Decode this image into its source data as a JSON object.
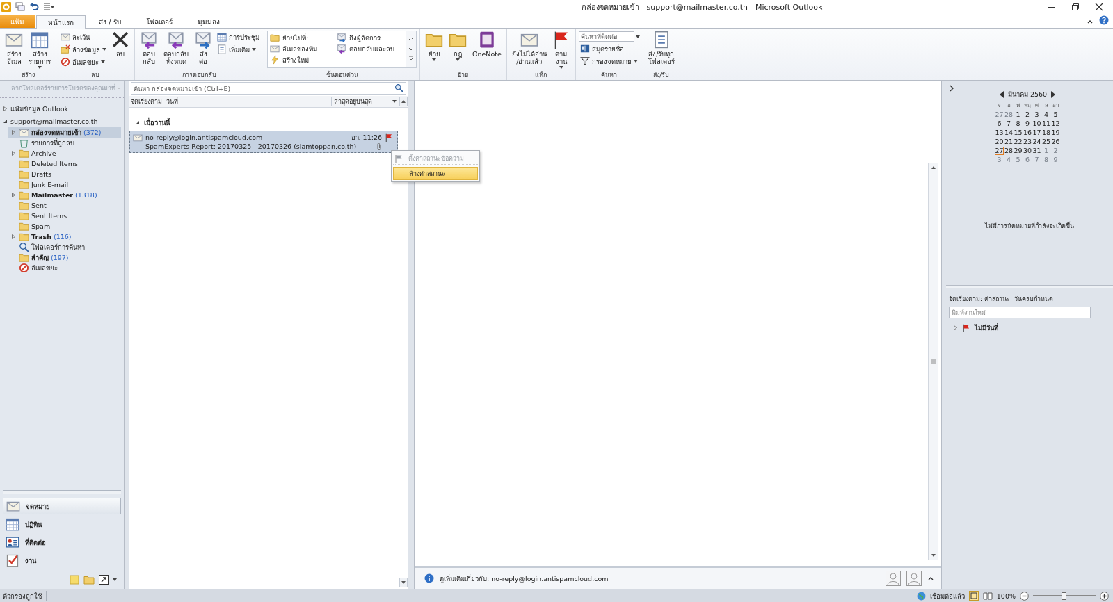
{
  "window": {
    "title": "กล่องจดหมายเข้า - support@mailmaster.co.th  -  Microsoft Outlook"
  },
  "tabs": [
    {
      "label": "แฟ้ม",
      "kind": "file",
      "selected": false
    },
    {
      "label": "หน้าแรก",
      "kind": "tab",
      "selected": true
    },
    {
      "label": "ส่ง / รับ",
      "kind": "tab",
      "selected": false
    },
    {
      "label": "โฟลเดอร์",
      "kind": "tab",
      "selected": false
    },
    {
      "label": "มุมมอง",
      "kind": "tab",
      "selected": false
    }
  ],
  "ribbon": [
    {
      "label": "สร้าง",
      "buttons": [
        {
          "label": "สร้าง\nอีเมล",
          "kind": "large",
          "dropdown": false
        },
        {
          "label": "สร้าง\nรายการ",
          "kind": "large",
          "dropdown": true
        }
      ]
    },
    {
      "label": "ลบ",
      "buttons": [
        {
          "label": "ละเว้น",
          "kind": "small",
          "dropdown": false
        },
        {
          "label": "ล้างข้อมูล",
          "kind": "small",
          "dropdown": true
        },
        {
          "label": "อีเมลขยะ",
          "kind": "small",
          "dropdown": true
        },
        {
          "label": "ลบ",
          "kind": "large",
          "dropdown": false
        }
      ]
    },
    {
      "label": "การตอบกลับ",
      "buttons": [
        {
          "label": "ตอบ\nกลับ",
          "kind": "large",
          "dropdown": false
        },
        {
          "label": "ตอบกลับ\nทั้งหมด",
          "kind": "large",
          "dropdown": false
        },
        {
          "label": "ส่ง\nต่อ",
          "kind": "large",
          "dropdown": false
        },
        {
          "label": "การประชุม",
          "kind": "small",
          "dropdown": false
        },
        {
          "label": "เพิ่มเติม",
          "kind": "small",
          "dropdown": true
        }
      ]
    },
    {
      "label": "ขั้นตอนด่วน",
      "buttons": [
        {
          "label": "ย้ายไปที่:",
          "kind": "gallery"
        },
        {
          "label": "อีเมลของทีม",
          "kind": "gallery"
        },
        {
          "label": "สร้างใหม่",
          "kind": "gallery"
        },
        {
          "label": "ถึงผู้จัดการ",
          "kind": "gallery"
        },
        {
          "label": "ตอบกลับและลบ",
          "kind": "gallery"
        }
      ]
    },
    {
      "label": "ย้าย",
      "buttons": [
        {
          "label": "ย้าย",
          "kind": "large",
          "dropdown": true
        },
        {
          "label": "กฎ",
          "kind": "large",
          "dropdown": true
        },
        {
          "label": "OneNote",
          "kind": "large",
          "dropdown": false
        }
      ]
    },
    {
      "label": "แท็ก",
      "buttons": [
        {
          "label": "ยังไม่ได้อ่าน\n/อ่านแล้ว",
          "kind": "large",
          "dropdown": false
        },
        {
          "label": "ตาม\nงาน",
          "kind": "large",
          "dropdown": true
        }
      ]
    },
    {
      "label": "ค้นหา",
      "buttons": [
        {
          "placeholder": "ค้นหาที่ติดต่อ",
          "kind": "combo",
          "dropdown": true
        },
        {
          "label": "สมุดรายชื่อ",
          "kind": "small",
          "dropdown": false
        },
        {
          "label": "กรองจดหมาย",
          "kind": "small",
          "dropdown": true
        }
      ]
    },
    {
      "label": "ส่ง/รับ",
      "buttons": [
        {
          "label": "ส่ง/รับทุก\nโฟลเดอร์",
          "kind": "large",
          "dropdown": false
        }
      ]
    }
  ],
  "folder_pane": {
    "header": "ลากโฟลเดอร์รายการโปรดของคุณมาที่",
    "tree": [
      {
        "label": "แฟ้มข้อมูล Outlook",
        "kind": "root",
        "selected": false,
        "bold": false,
        "expanded": false
      },
      {
        "label": "support@mailmaster.co.th",
        "kind": "root",
        "selected": false,
        "bold": false,
        "expanded": true,
        "children": [
          {
            "label": "กล่องจดหมายเข้า",
            "count": "(372)",
            "kind": "inbox",
            "selected": true,
            "bold": true,
            "expanded": false
          },
          {
            "label": "รายการที่ถูกลบ",
            "kind": "deleted",
            "selected": false,
            "bold": false
          },
          {
            "label": "Archive",
            "kind": "folder",
            "selected": false,
            "bold": false,
            "expanded": false
          },
          {
            "label": "Deleted Items",
            "kind": "folder",
            "selected": false,
            "bold": false
          },
          {
            "label": "Drafts",
            "kind": "folder",
            "selected": false,
            "bold": false
          },
          {
            "label": "Junk E-mail",
            "kind": "folder",
            "selected": false,
            "bold": false
          },
          {
            "label": "Mailmaster",
            "count": "(1318)",
            "kind": "folder",
            "selected": false,
            "bold": true,
            "expanded": false
          },
          {
            "label": "Sent",
            "kind": "folder",
            "selected": false,
            "bold": false
          },
          {
            "label": "Sent Items",
            "kind": "folder",
            "selected": false,
            "bold": false
          },
          {
            "label": "Spam",
            "kind": "folder",
            "selected": false,
            "bold": false
          },
          {
            "label": "Trash",
            "count": "(116)",
            "kind": "folder",
            "selected": false,
            "bold": true,
            "expanded": false
          },
          {
            "label": "โฟลเดอร์การค้นหา",
            "kind": "search",
            "selected": false,
            "bold": false
          },
          {
            "label": "สำคัญ",
            "count": "(197)",
            "kind": "folder",
            "selected": false,
            "bold": true
          },
          {
            "label": "อีเมลขยะ",
            "kind": "junk",
            "selected": false,
            "bold": false
          }
        ]
      }
    ],
    "nav": [
      {
        "label": "จดหมาย",
        "selected": true
      },
      {
        "label": "ปฏิทิน",
        "selected": false
      },
      {
        "label": "ที่ติดต่อ",
        "selected": false
      },
      {
        "label": "งาน",
        "selected": false
      }
    ]
  },
  "mail_list": {
    "search": {
      "placeholder": "ค้นหา กล่องจดหมายเข้า (Ctrl+E)"
    },
    "sort_by": "จัดเรียงตาม: วันที่",
    "order": "ล่าสุดอยู่บนสุด",
    "groups": [
      {
        "label": "เมื่อวานนี้",
        "expanded": true,
        "messages": [
          {
            "sender": "no-reply@login.antispamcloud.com",
            "time": "อา. 11:26",
            "subject": "SpamExperts Report: 20170325 - 20170326 (siamtoppan.co.th)",
            "selected": true,
            "attachment": true,
            "flagged": true
          }
        ]
      }
    ],
    "context_menu": [
      {
        "label": "ตั้งค่าสถานะข้อความ",
        "disabled": true,
        "highlighted": false
      },
      {
        "label": "ล้างค่าสถานะ",
        "disabled": false,
        "highlighted": true
      }
    ]
  },
  "people_pane": {
    "text": "ดูเพิ่มเติมเกี่ยวกับ: no-reply@login.antispamcloud.com"
  },
  "todo_bar": {
    "calendar": {
      "month": "มีนาคม 2560",
      "weekdays": [
        "จ",
        "อ",
        "พ",
        "พฤ",
        "ศ",
        "ส",
        "อา"
      ],
      "days": [
        {
          "label": "27",
          "outside": true,
          "today": false
        },
        {
          "label": "28",
          "outside": true,
          "today": false
        },
        {
          "label": "1",
          "outside": false,
          "today": false
        },
        {
          "label": "2",
          "outside": false,
          "today": false
        },
        {
          "label": "3",
          "outside": false,
          "today": false
        },
        {
          "label": "4",
          "outside": false,
          "today": false
        },
        {
          "label": "5",
          "outside": false,
          "today": false
        },
        {
          "label": "6",
          "outside": false,
          "today": false
        },
        {
          "label": "7",
          "outside": false,
          "today": false
        },
        {
          "label": "8",
          "outside": false,
          "today": false
        },
        {
          "label": "9",
          "outside": false,
          "today": false
        },
        {
          "label": "10",
          "outside": false,
          "today": false
        },
        {
          "label": "11",
          "outside": false,
          "today": false
        },
        {
          "label": "12",
          "outside": false,
          "today": false
        },
        {
          "label": "13",
          "outside": false,
          "today": false
        },
        {
          "label": "14",
          "outside": false,
          "today": false
        },
        {
          "label": "15",
          "outside": false,
          "today": false
        },
        {
          "label": "16",
          "outside": false,
          "today": false
        },
        {
          "label": "17",
          "outside": false,
          "today": false
        },
        {
          "label": "18",
          "outside": false,
          "today": false
        },
        {
          "label": "19",
          "outside": false,
          "today": false
        },
        {
          "label": "20",
          "outside": false,
          "today": false
        },
        {
          "label": "21",
          "outside": false,
          "today": false
        },
        {
          "label": "22",
          "outside": false,
          "today": false
        },
        {
          "label": "23",
          "outside": false,
          "today": false
        },
        {
          "label": "24",
          "outside": false,
          "today": false
        },
        {
          "label": "25",
          "outside": false,
          "today": false
        },
        {
          "label": "26",
          "outside": false,
          "today": false
        },
        {
          "label": "27",
          "outside": false,
          "today": true
        },
        {
          "label": "28",
          "outside": false,
          "today": false
        },
        {
          "label": "29",
          "outside": false,
          "today": false
        },
        {
          "label": "30",
          "outside": false,
          "today": false
        },
        {
          "label": "31",
          "outside": false,
          "today": false
        },
        {
          "label": "1",
          "outside": true,
          "today": false
        },
        {
          "label": "2",
          "outside": true,
          "today": false
        },
        {
          "label": "3",
          "outside": true,
          "today": false
        },
        {
          "label": "4",
          "outside": true,
          "today": false
        },
        {
          "label": "5",
          "outside": true,
          "today": false
        },
        {
          "label": "6",
          "outside": true,
          "today": false
        },
        {
          "label": "7",
          "outside": true,
          "today": false
        },
        {
          "label": "8",
          "outside": true,
          "today": false
        },
        {
          "label": "9",
          "outside": true,
          "today": false
        }
      ]
    },
    "appointments": "ไม่มีการนัดหมายที่กำลังจะเกิดขึ้น",
    "tasks": {
      "sort_by": "จัดเรียงตาม: ค่าสถานะ: วันครบกำหนด",
      "new_task": {
        "placeholder": "พิมพ์งานใหม่"
      },
      "groups": [
        {
          "label": "ไม่มีวันที่",
          "expanded": false
        }
      ]
    }
  },
  "status_bar": {
    "left": "ตัวกรองถูกใช้",
    "connection": "เชื่อมต่อแล้ว",
    "zoom": "100%",
    "zoom_slider": {
      "level": 0.5
    }
  }
}
